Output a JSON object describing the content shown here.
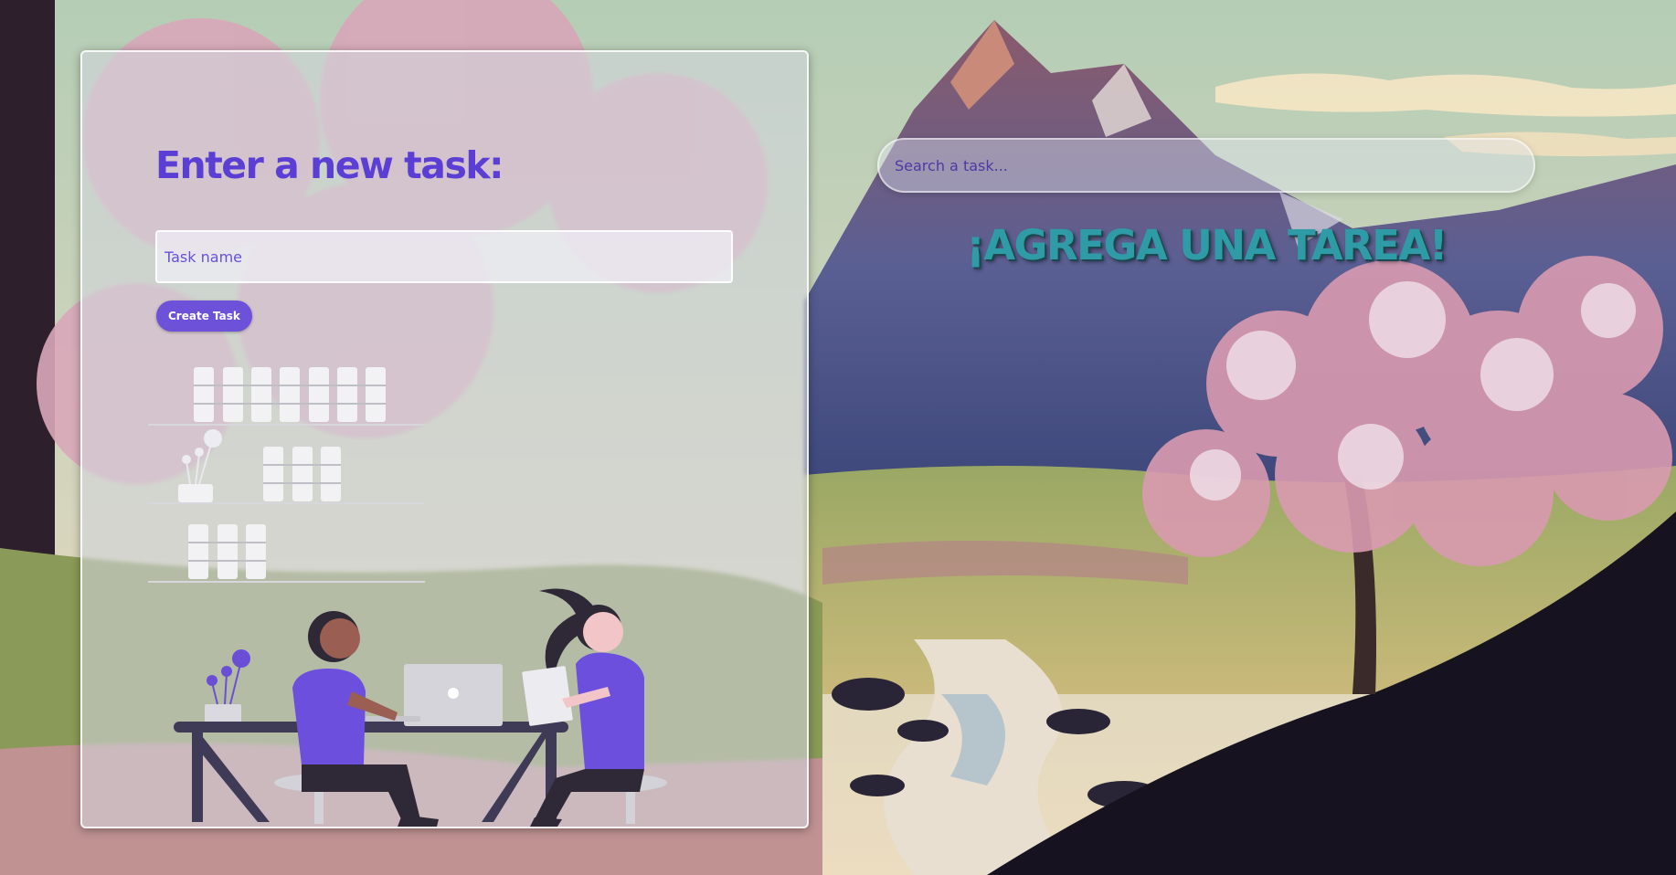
{
  "form": {
    "title": "Enter a new task:",
    "task_input_placeholder": "Task name",
    "task_input_value": "",
    "create_button_label": "Create Task"
  },
  "search": {
    "placeholder": "Search a task...",
    "value": ""
  },
  "empty_message": "¡AGREGA UNA TAREA!",
  "colors": {
    "accent_purple": "#6d52d9",
    "title_purple": "#5b3fd4",
    "teal_heading": "#2f9ba6"
  },
  "illustration": {
    "name": "two-people-working-at-desk",
    "icons": [
      "laptop-icon",
      "plant-icon",
      "bookshelf-icon"
    ]
  },
  "background": {
    "name": "mountain-cherry-blossom-landscape"
  }
}
